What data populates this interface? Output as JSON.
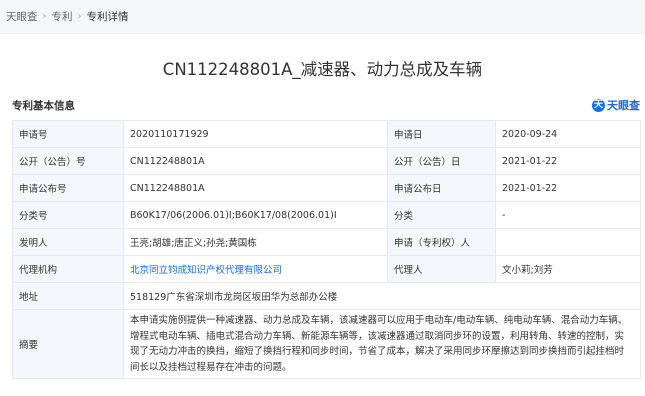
{
  "breadcrumb": {
    "items": [
      "天眼查",
      "专利",
      "专利详情"
    ],
    "separator": "›"
  },
  "page_title": "CN112248801A_减速器、动力总成及车辆",
  "section": {
    "title": "专利基本信息",
    "brand": {
      "icon_text": "天",
      "label": "天眼查"
    }
  },
  "fields": {
    "app_no": {
      "label": "申请号",
      "value": "2020110171929"
    },
    "app_date": {
      "label": "申请日",
      "value": "2020-09-24"
    },
    "pub_no": {
      "label": "公开（公告）号",
      "value": "CN112248801A"
    },
    "pub_date": {
      "label": "公开（公告）日",
      "value": "2021-01-22"
    },
    "app_pub_no": {
      "label": "申请公布号",
      "value": "CN112248801A"
    },
    "app_pub_date": {
      "label": "申请公布日",
      "value": "2021-01-22"
    },
    "classification": {
      "label": "分类号",
      "value": "B60K17/06(2006.01)I;B60K17/08(2006.01)I"
    },
    "category": {
      "label": "分类",
      "value": "-"
    },
    "inventors": {
      "label": "发明人",
      "value": "王亮;胡雄;唐正义;孙尧;黄国栋"
    },
    "applicant": {
      "label": "申请（专利权）人",
      "value": ""
    },
    "agency": {
      "label": "代理机构",
      "value": "北京同立钧成知识产权代理有限公司"
    },
    "agent": {
      "label": "代理人",
      "value": "文小莉;刘芳"
    },
    "address": {
      "label": "地址",
      "value": "518129广东省深圳市龙岗区坂田华为总部办公楼"
    },
    "abstract": {
      "label": "摘要",
      "value": "本申请实施例提供一种减速器、动力总成及车辆，该减速器可以应用于电动车/电动车辆、纯电动车辆、混合动力车辆、增程式电动车辆、插电式混合动力车辆、新能源车辆等，该减速器通过取消同步环的设置，利用转角、转速的控制，实现了无动力冲击的换挡，缩短了换挡行程和同步时间，节省了成本，解决了采用同步环摩擦达到同步换挡而引起挂档时间长以及挂档过程易存在冲击的问题。"
    }
  }
}
